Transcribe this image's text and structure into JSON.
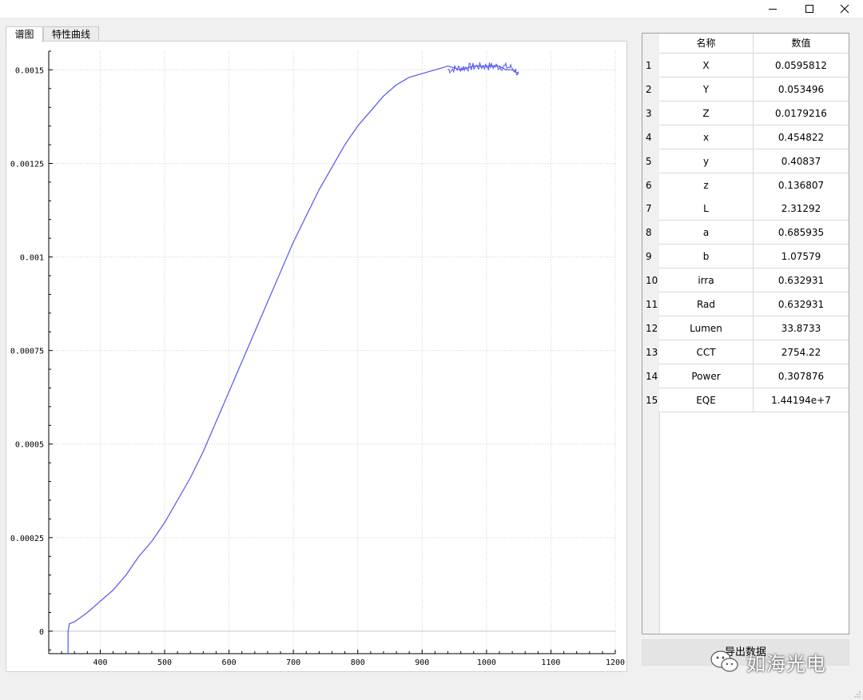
{
  "window": {
    "controls": [
      "minimize-icon",
      "maximize-icon",
      "close-icon"
    ]
  },
  "tabs": [
    {
      "label": "谱图",
      "active": true
    },
    {
      "label": "特性曲线",
      "active": false
    }
  ],
  "chart_data": {
    "type": "line",
    "title": "",
    "xlabel": "",
    "ylabel": "",
    "xlim": [
      320,
      1200
    ],
    "ylim": [
      -6e-05,
      0.00155
    ],
    "x_ticks": [
      400,
      500,
      600,
      700,
      800,
      900,
      1000,
      1100,
      1200
    ],
    "x_tick_labels": [
      "400",
      "500",
      "600",
      "700",
      "800",
      "900",
      "1000",
      "1100",
      "1200"
    ],
    "y_ticks": [
      0,
      0.00025,
      0.0005,
      0.00075,
      0.001,
      0.00125,
      0.0015
    ],
    "y_tick_labels": [
      "0",
      "0.00025",
      "0.0005",
      "0.00075",
      "0.001",
      "0.00125",
      "0.0015"
    ],
    "grid": true,
    "line_color": "#5555ee",
    "series": [
      {
        "x": [
          350,
          352,
          360,
          380,
          400,
          420,
          440,
          460,
          480,
          500,
          520,
          540,
          560,
          580,
          600,
          620,
          640,
          660,
          680,
          700,
          720,
          740,
          760,
          780,
          800,
          820,
          840,
          860,
          880,
          900,
          920,
          940,
          960,
          980,
          1000,
          1020,
          1030,
          1040,
          1050
        ],
        "y": [
          0,
          2e-05,
          2.5e-05,
          5e-05,
          8e-05,
          0.00011,
          0.00015,
          0.0002,
          0.00024,
          0.00029,
          0.00035,
          0.00041,
          0.00048,
          0.00056,
          0.00064,
          0.00072,
          0.0008,
          0.00088,
          0.00096,
          0.00104,
          0.00111,
          0.00118,
          0.00124,
          0.0013,
          0.00135,
          0.00139,
          0.00143,
          0.00146,
          0.00148,
          0.00149,
          0.0015,
          0.00151,
          0.0015,
          0.00151,
          0.00151,
          0.00151,
          0.0015,
          0.0015,
          0.00149
        ]
      }
    ]
  },
  "table": {
    "headers": {
      "name": "名称",
      "value": "数值"
    },
    "rows": [
      {
        "num": "1",
        "name": "X",
        "value": "0.0595812"
      },
      {
        "num": "2",
        "name": "Y",
        "value": "0.053496"
      },
      {
        "num": "3",
        "name": "Z",
        "value": "0.0179216"
      },
      {
        "num": "4",
        "name": "x",
        "value": "0.454822"
      },
      {
        "num": "5",
        "name": "y",
        "value": "0.40837"
      },
      {
        "num": "6",
        "name": "z",
        "value": "0.136807"
      },
      {
        "num": "7",
        "name": "L",
        "value": "2.31292"
      },
      {
        "num": "8",
        "name": "a",
        "value": "0.685935"
      },
      {
        "num": "9",
        "name": "b",
        "value": "1.07579"
      },
      {
        "num": "10",
        "name": "irra",
        "value": "0.632931"
      },
      {
        "num": "11",
        "name": "Rad",
        "value": "0.632931"
      },
      {
        "num": "12",
        "name": "Lumen",
        "value": "33.8733"
      },
      {
        "num": "13",
        "name": "CCT",
        "value": "2754.22"
      },
      {
        "num": "14",
        "name": "Power",
        "value": "0.307876"
      },
      {
        "num": "15",
        "name": "EQE",
        "value": "1.44194e+7"
      }
    ]
  },
  "export_button": {
    "label": "导出数据"
  },
  "watermark": {
    "text": "如海光电",
    "icon": "wechat-icon"
  }
}
